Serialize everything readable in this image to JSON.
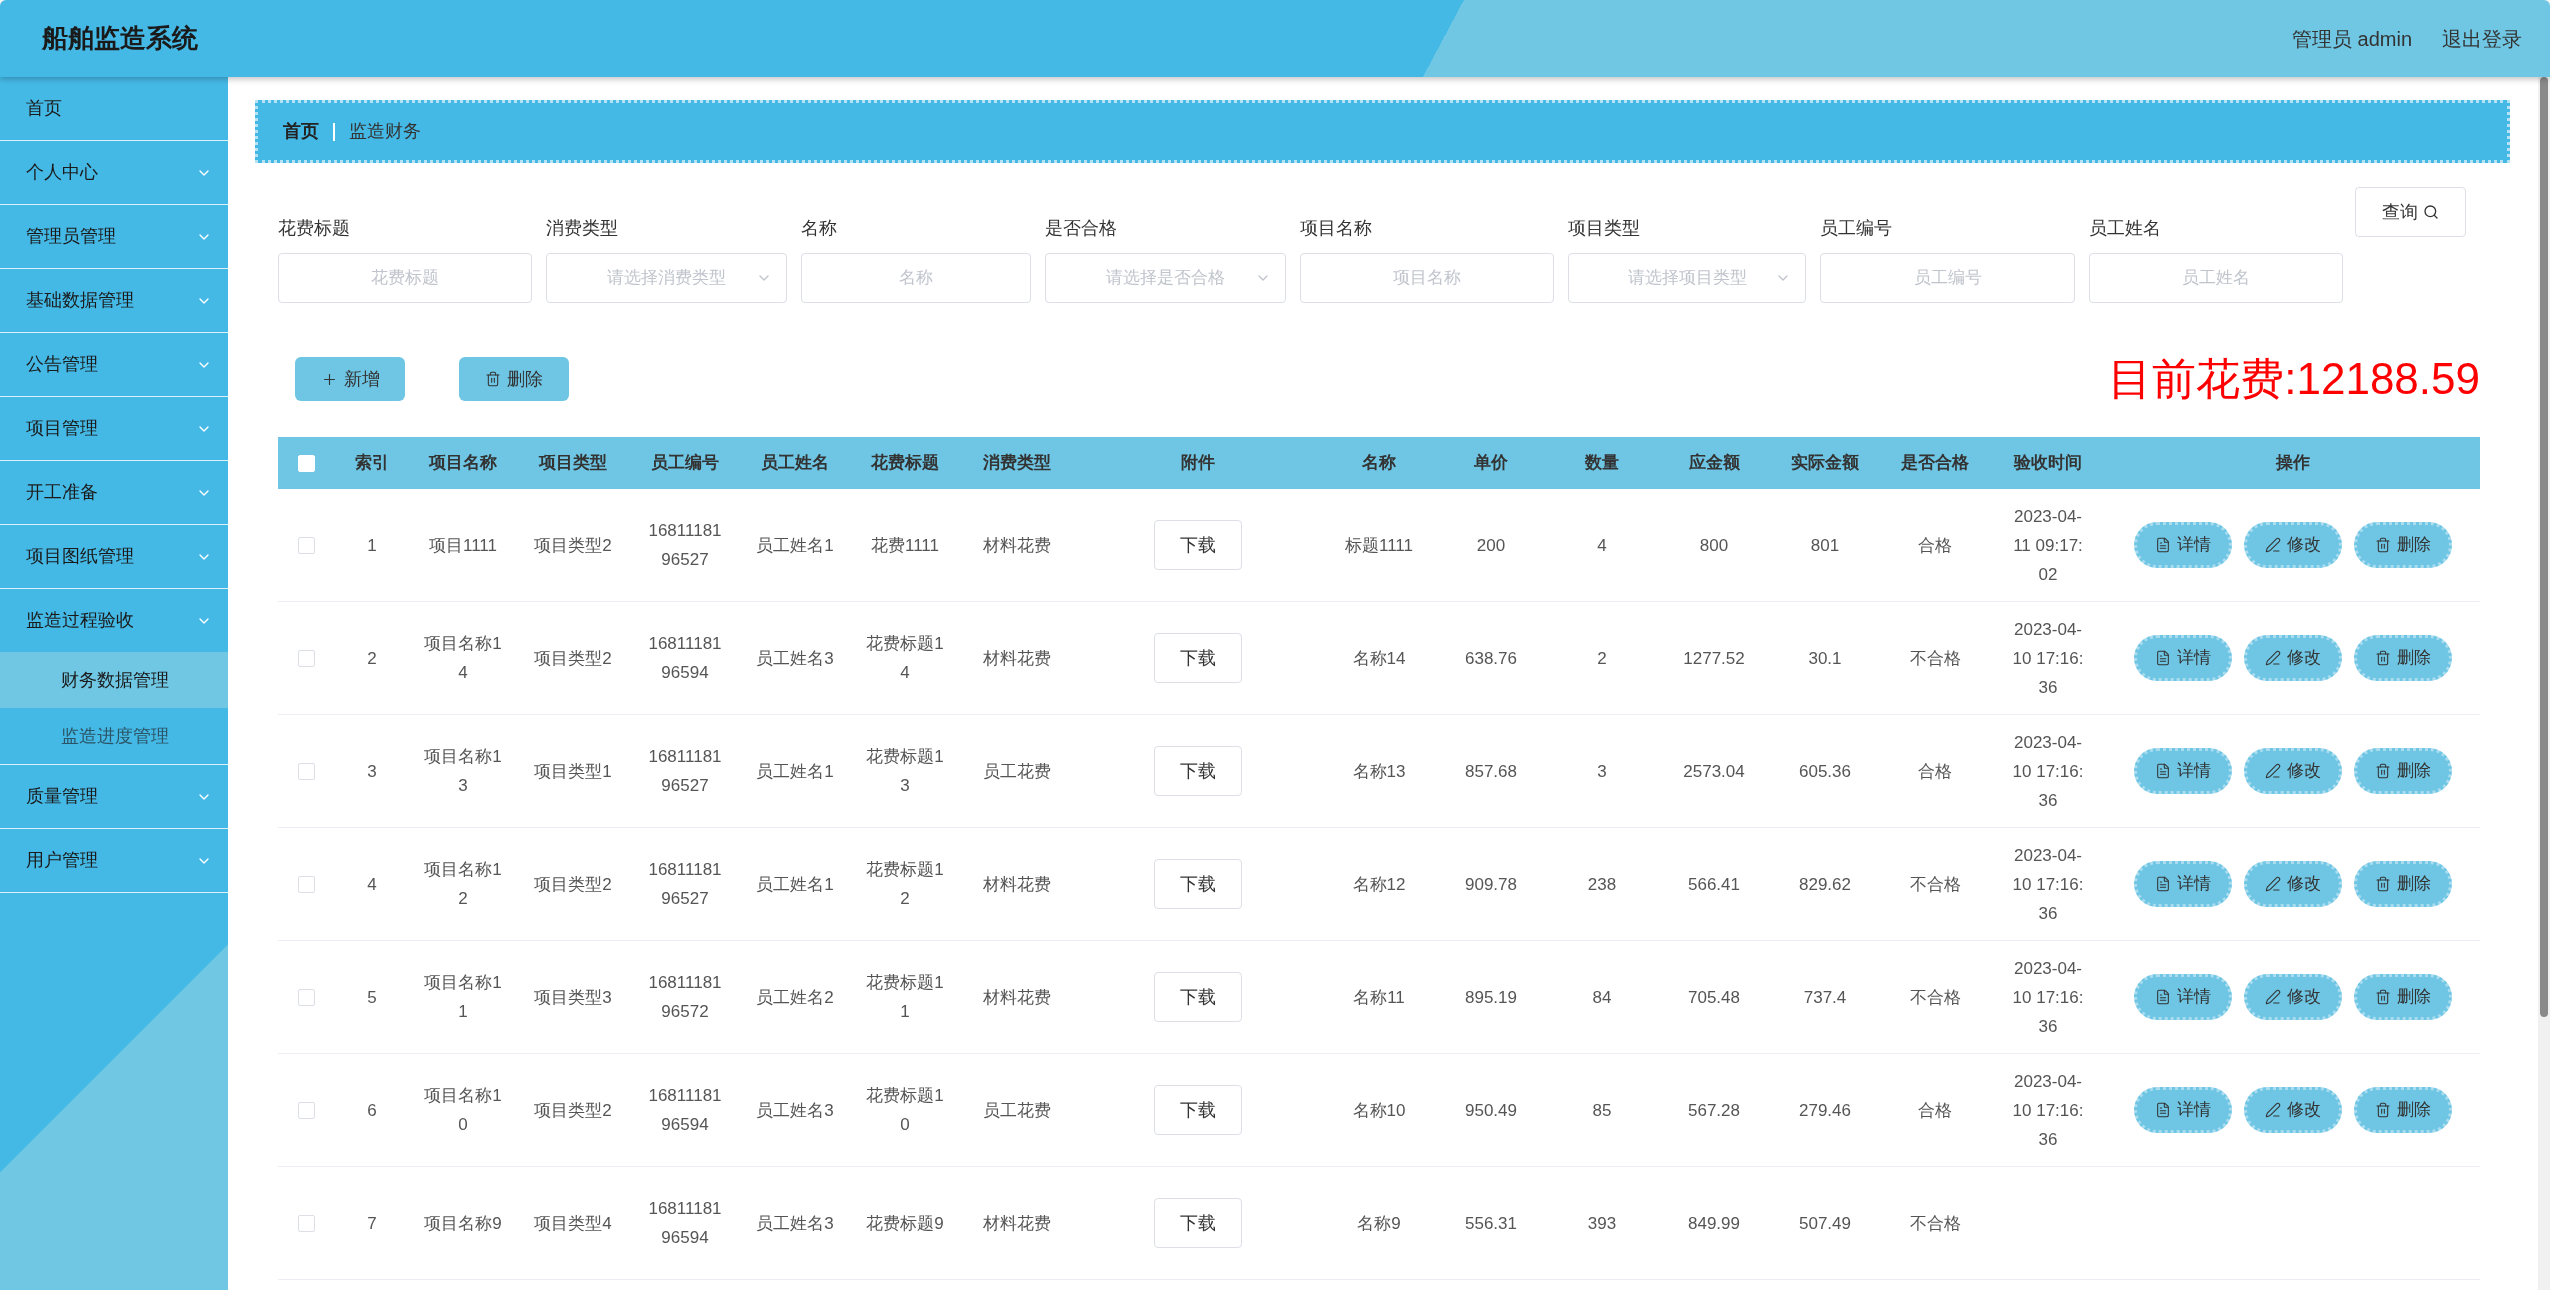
{
  "app_title": "船舶监造系统",
  "header_links": [
    "管理员 admin",
    "退出登录"
  ],
  "sidebar": {
    "items": [
      {
        "label": "首页",
        "has_children": false
      },
      {
        "label": "个人中心",
        "has_children": true,
        "expanded": false
      },
      {
        "label": "管理员管理",
        "has_children": true,
        "expanded": false
      },
      {
        "label": "基础数据管理",
        "has_children": true,
        "expanded": false
      },
      {
        "label": "公告管理",
        "has_children": true,
        "expanded": false
      },
      {
        "label": "项目管理",
        "has_children": true,
        "expanded": false
      },
      {
        "label": "开工准备",
        "has_children": true,
        "expanded": false
      },
      {
        "label": "项目图纸管理",
        "has_children": true,
        "expanded": false
      },
      {
        "label": "监造过程验收",
        "has_children": true,
        "expanded": true,
        "children": [
          {
            "label": "财务数据管理",
            "selected": true
          },
          {
            "label": "监造进度管理",
            "selected": false
          }
        ]
      },
      {
        "label": "质量管理",
        "has_children": true,
        "expanded": false
      },
      {
        "label": "用户管理",
        "has_children": true,
        "expanded": false
      }
    ]
  },
  "breadcrumb": [
    "首页",
    "监造财务"
  ],
  "filters": [
    {
      "label": "花费标题",
      "kind": "input",
      "placeholder": "花费标题"
    },
    {
      "label": "消费类型",
      "kind": "select",
      "placeholder": "请选择消费类型"
    },
    {
      "label": "名称",
      "kind": "input",
      "placeholder": "名称"
    },
    {
      "label": "是否合格",
      "kind": "select",
      "placeholder": "请选择是否合格"
    },
    {
      "label": "项目名称",
      "kind": "input",
      "placeholder": "项目名称"
    },
    {
      "label": "项目类型",
      "kind": "select",
      "placeholder": "请选择项目类型"
    },
    {
      "label": "员工编号",
      "kind": "input",
      "placeholder": "员工编号"
    },
    {
      "label": "员工姓名",
      "kind": "input",
      "placeholder": "员工姓名"
    }
  ],
  "query_button": "查询",
  "toolbar": [
    {
      "label": "新增",
      "kind": "add"
    },
    {
      "label": "删除",
      "kind": "delete"
    }
  ],
  "total_cost": "目前花费:12188.59",
  "table": {
    "select_all_checked": false,
    "columns": [
      "索引",
      "项目名称",
      "项目类型",
      "员工编号",
      "员工姓名",
      "花费标题",
      "消费类型",
      "附件",
      "名称",
      "单价",
      "数量",
      "应金额",
      "实际金额",
      "是否合格",
      "验收时间",
      "操作"
    ],
    "rows": [
      {
        "checked": false,
        "cells": [
          "1",
          "项目1111",
          "项目类型2",
          "1681118196527",
          "员工姓名1",
          "花费1111",
          "材料花费",
          "下载",
          "标题1111",
          "200",
          "4",
          "800",
          "801",
          "合格",
          "2023-04-11 09:17:02"
        ],
        "actions": [
          "详情",
          "修改",
          "删除"
        ]
      },
      {
        "checked": false,
        "cells": [
          "2",
          "项目名称14",
          "项目类型2",
          "1681118196594",
          "员工姓名3",
          "花费标题14",
          "材料花费",
          "下载",
          "名称14",
          "638.76",
          "2",
          "1277.52",
          "30.1",
          "不合格",
          "2023-04-10 17:16:36"
        ],
        "actions": [
          "详情",
          "修改",
          "删除"
        ]
      },
      {
        "checked": false,
        "cells": [
          "3",
          "项目名称13",
          "项目类型1",
          "1681118196527",
          "员工姓名1",
          "花费标题13",
          "员工花费",
          "下载",
          "名称13",
          "857.68",
          "3",
          "2573.04",
          "605.36",
          "合格",
          "2023-04-10 17:16:36"
        ],
        "actions": [
          "详情",
          "修改",
          "删除"
        ]
      },
      {
        "checked": false,
        "cells": [
          "4",
          "项目名称12",
          "项目类型2",
          "1681118196527",
          "员工姓名1",
          "花费标题12",
          "材料花费",
          "下载",
          "名称12",
          "909.78",
          "238",
          "566.41",
          "829.62",
          "不合格",
          "2023-04-10 17:16:36"
        ],
        "actions": [
          "详情",
          "修改",
          "删除"
        ]
      },
      {
        "checked": false,
        "cells": [
          "5",
          "项目名称11",
          "项目类型3",
          "1681118196572",
          "员工姓名2",
          "花费标题11",
          "材料花费",
          "下载",
          "名称11",
          "895.19",
          "84",
          "705.48",
          "737.4",
          "不合格",
          "2023-04-10 17:16:36"
        ],
        "actions": [
          "详情",
          "修改",
          "删除"
        ]
      },
      {
        "checked": false,
        "cells": [
          "6",
          "项目名称10",
          "项目类型2",
          "1681118196594",
          "员工姓名3",
          "花费标题10",
          "员工花费",
          "下载",
          "名称10",
          "950.49",
          "85",
          "567.28",
          "279.46",
          "合格",
          "2023-04-10 17:16:36"
        ],
        "actions": [
          "详情",
          "修改",
          "删除"
        ]
      },
      {
        "checked": false,
        "cells": [
          "7",
          "项目名称9",
          "项目类型4",
          "1681118196594",
          "员工姓名3",
          "花费标题9",
          "材料花费",
          "下载",
          "名称9",
          "556.31",
          "393",
          "849.99",
          "507.49",
          "不合格"
        ]
      }
    ]
  }
}
